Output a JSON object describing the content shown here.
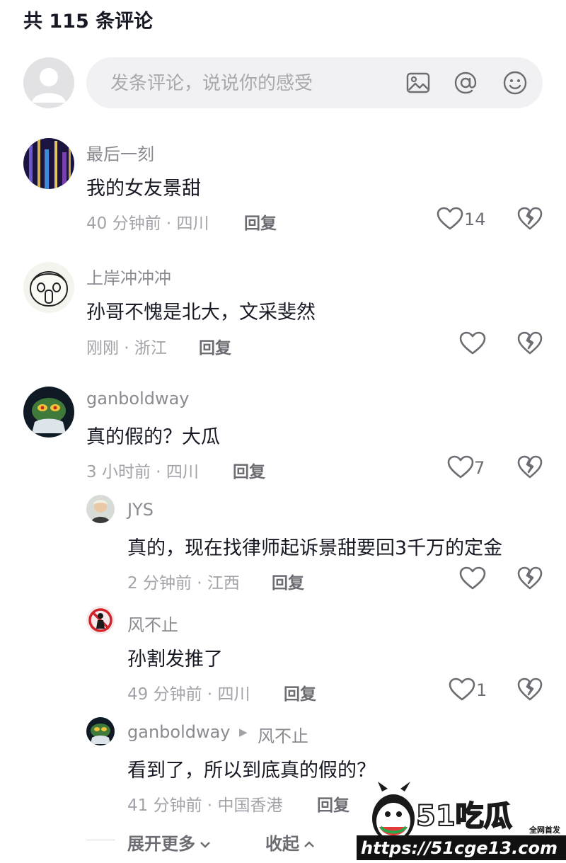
{
  "header": {
    "title": "共 115 条评论"
  },
  "composer": {
    "placeholder": "发条评论，说说你的感受",
    "icons": [
      "image-icon",
      "at-icon",
      "emoji-icon"
    ]
  },
  "comments": [
    {
      "username": "最后一刻",
      "text": "我的女友景甜",
      "time_location": "40 分钟前 · 四川",
      "reply_label": "回复",
      "likes": "14"
    },
    {
      "username": "上岸冲冲冲",
      "text": "孙哥不愧是北大，文采斐然",
      "time_location": "刚刚 · 浙江",
      "reply_label": "回复",
      "likes": ""
    },
    {
      "username": "ganboldway",
      "text": "真的假的？大瓜",
      "time_location": "3 小时前 · 四川",
      "reply_label": "回复",
      "likes": "7"
    }
  ],
  "replies": [
    {
      "username": "JYS",
      "text": "真的，现在找律师起诉景甜要回3千万的定金",
      "time_location": "2 分钟前 · 江西",
      "reply_label": "回复",
      "likes": ""
    },
    {
      "username": "风不止",
      "text": "孙割发推了",
      "time_location": "49 分钟前 · 四川",
      "reply_label": "回复",
      "likes": "1"
    },
    {
      "username": "ganboldway",
      "reply_to": "风不止",
      "text": "看到了，所以到底真的假的？",
      "time_location": "41 分钟前 · 中国香港",
      "reply_label": "回复",
      "likes": ""
    }
  ],
  "footer": {
    "expand_label": "展开更多",
    "collapse_label": "收起"
  },
  "watermark": {
    "brand": "51吃瓜",
    "badge": "全网首发",
    "url": "https://51cge13.com"
  },
  "colors": {
    "text": "#161823",
    "meta": "#a2a3a8",
    "input_bg": "#f1f1f3",
    "icon": "#6c6d73"
  }
}
